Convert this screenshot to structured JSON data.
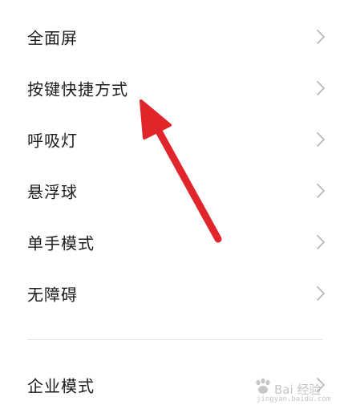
{
  "settings": {
    "items": [
      {
        "label": "全面屏",
        "icon": "chevron-right-icon"
      },
      {
        "label": "按键快捷方式",
        "icon": "chevron-right-icon"
      },
      {
        "label": "呼吸灯",
        "icon": "chevron-right-icon"
      },
      {
        "label": "悬浮球",
        "icon": "chevron-right-icon"
      },
      {
        "label": "单手模式",
        "icon": "chevron-right-icon"
      },
      {
        "label": "无障碍",
        "icon": "chevron-right-icon"
      },
      {
        "label": "企业模式",
        "icon": "chevron-right-icon"
      }
    ]
  },
  "annotation": {
    "type": "arrow",
    "color": "#e0252b",
    "points_to": "按键快捷方式"
  },
  "watermark": {
    "text": "Bai 经验",
    "sub": "jingyan.baidu.com"
  },
  "colors": {
    "background": "#ffffff",
    "text": "#1c1c1c",
    "chevron": "#b8b8b8",
    "divider": "#e6e6e6"
  }
}
